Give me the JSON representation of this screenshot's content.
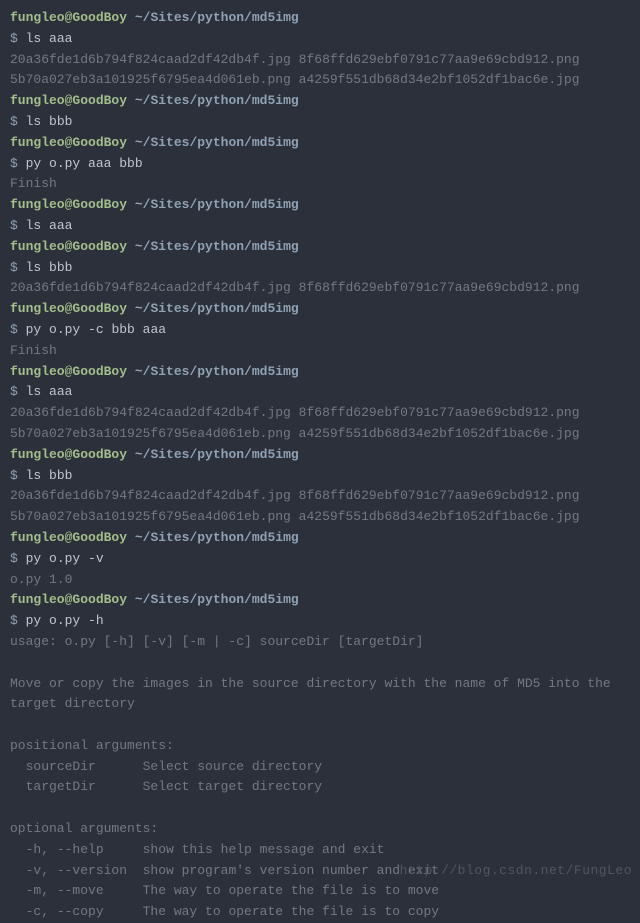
{
  "prompt": {
    "user": "fungleo@GoodBoy",
    "path": "~/Sites/python/md5img",
    "symbol": "$"
  },
  "files": {
    "f1": "20a36fde1d6b794f824caad2df42db4f.jpg",
    "f2": "8f68ffd629ebf0791c77aa9e69cbd912.png",
    "f3": "5b70a027eb3a101925f6795ea4d061eb.png",
    "f4": "a4259f551db68d34e2bf1052df1bac6e.jpg"
  },
  "commands": {
    "ls_aaa": "ls aaa",
    "ls_bbb": "ls bbb",
    "py_aaa_bbb": "py o.py aaa bbb",
    "py_c_bbb_aaa": "py o.py -c bbb aaa",
    "py_v": "py o.py -v",
    "py_h": "py o.py -h"
  },
  "output": {
    "finish": "Finish",
    "version": "o.py 1.0"
  },
  "help": {
    "usage": "usage: o.py [-h] [-v] [-m | -c] sourceDir [targetDir]",
    "blank": "",
    "desc1": "Move or copy the images in the source directory with the name of MD5 into the",
    "desc2": "target directory",
    "pos_header": "positional arguments:",
    "pos_source": "  sourceDir      Select source directory",
    "pos_target": "  targetDir      Select target directory",
    "opt_header": "optional arguments:",
    "opt_h": "  -h, --help     show this help message and exit",
    "opt_v": "  -v, --version  show program's version number and exit",
    "opt_m": "  -m, --move     The way to operate the file is to move",
    "opt_c": "  -c, --copy     The way to operate the file is to copy"
  },
  "watermark": "http://blog.csdn.net/FungLeo"
}
